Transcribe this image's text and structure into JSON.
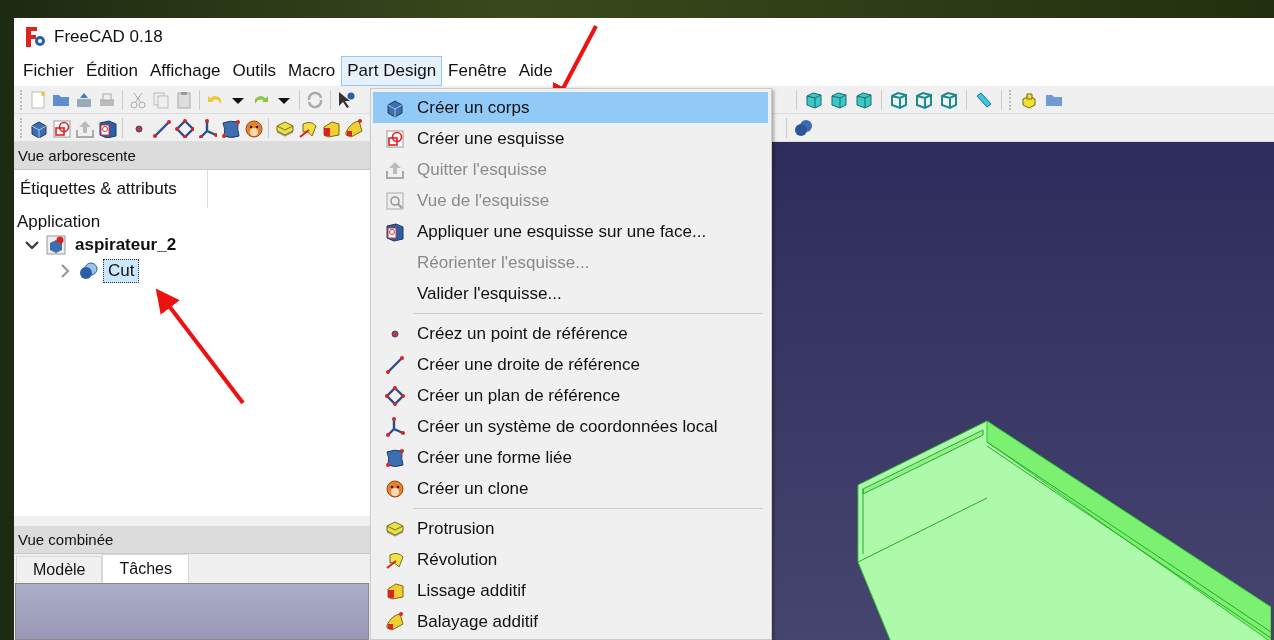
{
  "window": {
    "title": "FreeCAD 0.18"
  },
  "menu_bar": [
    {
      "label": "Fichier",
      "selected": false
    },
    {
      "label": "Édition",
      "selected": false
    },
    {
      "label": "Affichage",
      "selected": false
    },
    {
      "label": "Outils",
      "selected": false
    },
    {
      "label": "Macro",
      "selected": false
    },
    {
      "label": "Part Design",
      "selected": true
    },
    {
      "label": "Fenêtre",
      "selected": false
    },
    {
      "label": "Aide",
      "selected": false
    }
  ],
  "tree_panel": {
    "title": "Vue arborescente",
    "column_header": "Étiquettes & attributs",
    "root": "Application",
    "children": [
      {
        "label": "aspirateur_2",
        "expanded": true,
        "selected": false,
        "children": [
          {
            "label": "Cut",
            "expanded": false,
            "selected": true
          }
        ]
      }
    ]
  },
  "combo_panel": {
    "title": "Vue combinée",
    "tabs": [
      {
        "label": "Modèle",
        "selected": false
      },
      {
        "label": "Tâches",
        "selected": true
      }
    ]
  },
  "dropdown_menu": {
    "sections": [
      [
        {
          "label": "Créer un corps",
          "disabled": false,
          "selected": true
        },
        {
          "label": "Créer une esquisse",
          "disabled": false,
          "selected": false
        },
        {
          "label": "Quitter l'esquisse",
          "disabled": true,
          "selected": false
        },
        {
          "label": "Vue de l'esquisse",
          "disabled": true,
          "selected": false
        },
        {
          "label": "Appliquer une esquisse sur une face...",
          "disabled": false,
          "selected": false
        },
        {
          "label": "Réorienter l'esquisse...",
          "disabled": true,
          "selected": false
        },
        {
          "label": "Valider l'esquisse...",
          "disabled": false,
          "selected": false
        }
      ],
      [
        {
          "label": "Créez un point de référence",
          "disabled": false,
          "selected": false
        },
        {
          "label": "Créer une droite de référence",
          "disabled": false,
          "selected": false
        },
        {
          "label": "Créer un plan de référence",
          "disabled": false,
          "selected": false
        },
        {
          "label": "Créer un système de coordonnées local",
          "disabled": false,
          "selected": false
        },
        {
          "label": "Créer une forme liée",
          "disabled": false,
          "selected": false
        },
        {
          "label": "Créer un clone",
          "disabled": false,
          "selected": false
        }
      ],
      [
        {
          "label": "Protrusion",
          "disabled": false,
          "selected": false
        },
        {
          "label": "Révolution",
          "disabled": false,
          "selected": false
        },
        {
          "label": "Lissage additif",
          "disabled": false,
          "selected": false
        },
        {
          "label": "Balayage additif",
          "disabled": false,
          "selected": false
        }
      ]
    ]
  }
}
